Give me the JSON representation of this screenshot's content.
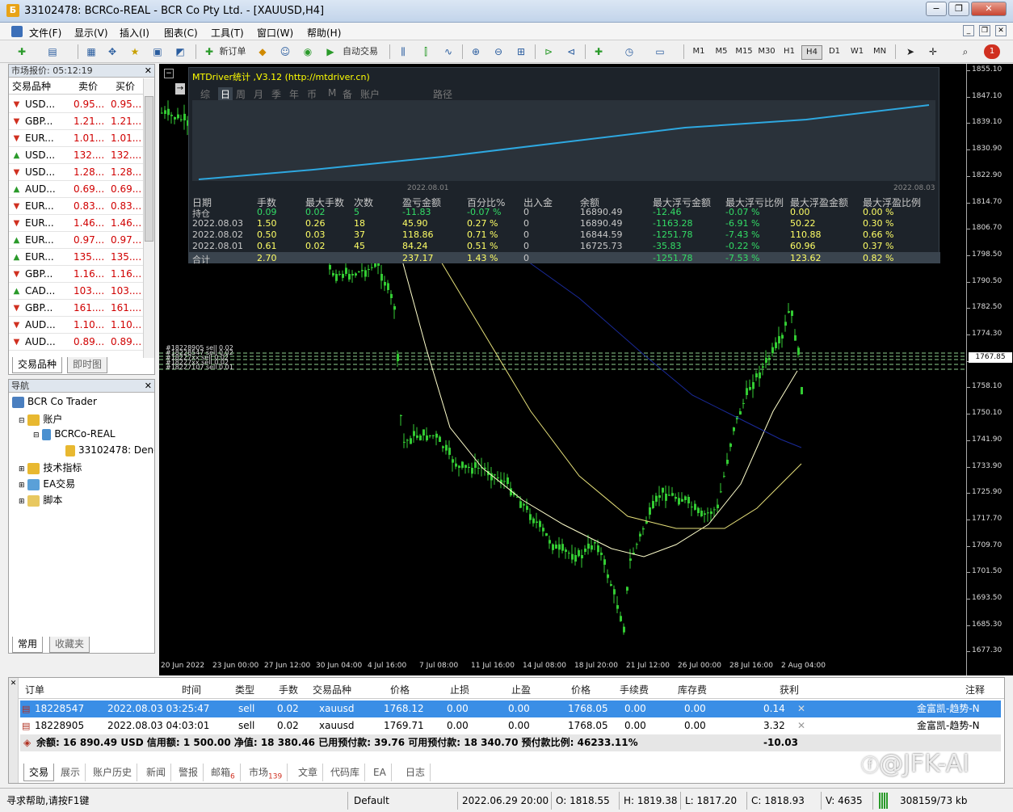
{
  "window": {
    "title": "33102478: BCRCo-REAL - BCR Co Pty Ltd. - [XAUUSD,H4]",
    "minimize": "−",
    "restore": "❐",
    "close": "✕"
  },
  "menu": [
    "文件(F)",
    "显示(V)",
    "插入(I)",
    "图表(C)",
    "工具(T)",
    "窗口(W)",
    "帮助(H)"
  ],
  "toolbar": {
    "new_order": "新订单",
    "auto_trade": "自动交易",
    "timeframes": [
      "M1",
      "M5",
      "M15",
      "M30",
      "H1",
      "H4",
      "D1",
      "W1",
      "MN"
    ],
    "active_tf": "H4",
    "alert_count": "1"
  },
  "market_watch": {
    "title": "市场报价: 05:12:19",
    "col_symbol": "交易品种",
    "col_bid": "卖价",
    "col_ask": "买价",
    "rows": [
      {
        "symbol": "USD...",
        "bid": "0.95...",
        "ask": "0.95...",
        "dir": "down"
      },
      {
        "symbol": "GBP...",
        "bid": "1.21...",
        "ask": "1.21...",
        "dir": "down"
      },
      {
        "symbol": "EUR...",
        "bid": "1.01...",
        "ask": "1.01...",
        "dir": "down"
      },
      {
        "symbol": "USD...",
        "bid": "132....",
        "ask": "132....",
        "dir": "up"
      },
      {
        "symbol": "USD...",
        "bid": "1.28...",
        "ask": "1.28...",
        "dir": "down"
      },
      {
        "symbol": "AUD...",
        "bid": "0.69...",
        "ask": "0.69...",
        "dir": "up"
      },
      {
        "symbol": "EUR...",
        "bid": "0.83...",
        "ask": "0.83...",
        "dir": "down"
      },
      {
        "symbol": "EUR...",
        "bid": "1.46...",
        "ask": "1.46...",
        "dir": "down"
      },
      {
        "symbol": "EUR...",
        "bid": "0.97...",
        "ask": "0.97...",
        "dir": "up"
      },
      {
        "symbol": "EUR...",
        "bid": "135....",
        "ask": "135....",
        "dir": "up"
      },
      {
        "symbol": "GBP...",
        "bid": "1.16...",
        "ask": "1.16...",
        "dir": "down"
      },
      {
        "symbol": "CAD...",
        "bid": "103....",
        "ask": "103....",
        "dir": "up"
      },
      {
        "symbol": "GBP...",
        "bid": "161....",
        "ask": "161....",
        "dir": "down"
      },
      {
        "symbol": "AUD...",
        "bid": "1.10...",
        "ask": "1.10...",
        "dir": "down"
      },
      {
        "symbol": "AUD...",
        "bid": "0.89...",
        "ask": "0.89...",
        "dir": "down"
      }
    ],
    "tabs": [
      "交易品种",
      "即时图"
    ]
  },
  "navigator": {
    "title": "导航",
    "items": [
      "BCR Co Trader",
      "账户",
      "BCRCo-REAL",
      "33102478: Deng",
      "技术指标",
      "EA交易",
      "脚本"
    ],
    "tabs": [
      "常用",
      "收藏夹"
    ]
  },
  "chart": {
    "indicator_title": "MTDriver统计 ,V3.12 (http://mtdriver.cn)",
    "stat_tabs": [
      "综",
      "日",
      "周",
      "月",
      "季",
      "年",
      "币",
      "M",
      "备",
      "账户",
      "路径"
    ],
    "active_stat_tab": "日",
    "curve_start_label": "2022.08.01",
    "curve_end_label": "2022.08.03",
    "stat_headers": [
      "日期",
      "手数",
      "最大手数",
      "次数",
      "盈亏金额",
      "百分比%",
      "出入金",
      "余额",
      "最大浮亏金额",
      "最大浮亏比例",
      "最大浮盈金额",
      "最大浮盈比例"
    ],
    "stat_rows": [
      [
        "持仓",
        "0.09",
        "0.02",
        "5",
        "-11.83",
        "-0.07 %",
        "0",
        "16890.49",
        "-12.46",
        "-0.07 %",
        "0.00",
        "0.00 %"
      ],
      [
        "2022.08.03",
        "1.50",
        "0.26",
        "18",
        "45.90",
        "0.27 %",
        "0",
        "16890.49",
        "-1163.28",
        "-6.91 %",
        "50.22",
        "0.30 %"
      ],
      [
        "2022.08.02",
        "0.50",
        "0.03",
        "37",
        "118.86",
        "0.71 %",
        "0",
        "16844.59",
        "-1251.78",
        "-7.43 %",
        "110.88",
        "0.66 %"
      ],
      [
        "2022.08.01",
        "0.61",
        "0.02",
        "45",
        "84.24",
        "0.51 %",
        "0",
        "16725.73",
        "-35.83",
        "-0.22 %",
        "60.96",
        "0.37 %"
      ]
    ],
    "stat_total": [
      "合计",
      "2.70",
      "",
      "",
      "237.17",
      "1.43 %",
      "0",
      "",
      "-1251.78",
      "-7.53 %",
      "123.62",
      "0.82 %"
    ],
    "order_labels": [
      "#18228905 sell 0.02",
      "#18228547 sell 0.02",
      "#18227xx sell 0.02",
      "#18227xx sell 0.02",
      "#18227107 sell 0.01"
    ],
    "price_labels": [
      "1855.10",
      "1847.10",
      "1839.10",
      "1830.90",
      "1822.90",
      "1814.70",
      "1806.70",
      "1798.50",
      "1790.50",
      "1782.50",
      "1774.30",
      "1766.30",
      "1758.10",
      "1750.10",
      "1741.90",
      "1733.90",
      "1725.90",
      "1717.70",
      "1709.70",
      "1701.50",
      "1693.50",
      "1685.30",
      "1677.30"
    ],
    "current_price": "1767.85",
    "time_labels": [
      "20 Jun 2022",
      "23 Jun 00:00",
      "27 Jun 12:00",
      "30 Jun 04:00",
      "4 Jul 16:00",
      "7 Jul 08:00",
      "11 Jul 16:00",
      "14 Jul 08:00",
      "18 Jul 20:00",
      "21 Jul 12:00",
      "26 Jul 00:00",
      "28 Jul 16:00",
      "2 Aug 04:00"
    ],
    "colors": {
      "up_candle": "#33cc33",
      "panel_bg": "#1d232a",
      "curve": "#2ea8e0",
      "ma_fast": "#ffffcc",
      "ma_slow": "#e6e07a",
      "ma_long": "#1a2a9a"
    }
  },
  "orders": {
    "headers": {
      "order": "订单",
      "time": "时间",
      "type": "类型",
      "lots": "手数",
      "symbol": "交易品种",
      "price": "价格",
      "sl": "止损",
      "tp": "止盈",
      "cur_price": "价格",
      "commission": "手续费",
      "swap": "库存费",
      "profit": "获利",
      "comment": "注释"
    },
    "rows": [
      {
        "order": "18228547",
        "time": "2022.08.03 03:25:47",
        "type": "sell",
        "lots": "0.02",
        "symbol": "xauusd",
        "price": "1768.12",
        "sl": "0.00",
        "tp": "0.00",
        "cur_price": "1768.05",
        "commission": "0.00",
        "swap": "0.00",
        "profit": "0.14",
        "comment": "金富凯-趋势-N",
        "selected": true
      },
      {
        "order": "18228905",
        "time": "2022.08.03 04:03:01",
        "type": "sell",
        "lots": "0.02",
        "symbol": "xauusd",
        "price": "1769.71",
        "sl": "0.00",
        "tp": "0.00",
        "cur_price": "1768.05",
        "commission": "0.00",
        "swap": "0.00",
        "profit": "3.32",
        "comment": "金富凯-趋势-N",
        "selected": false
      }
    ],
    "summary": "余额: 16 890.49 USD  信用额: 1 500.00  净值: 18 380.46  已用预付款: 39.76  可用预付款: 18 340.70  预付款比例: 46233.11%",
    "summary_profit": "-10.03",
    "tabs": [
      {
        "label": "交易",
        "badge": ""
      },
      {
        "label": "展示",
        "badge": ""
      },
      {
        "label": "账户历史",
        "badge": ""
      },
      {
        "label": "新闻",
        "badge": ""
      },
      {
        "label": "警报",
        "badge": ""
      },
      {
        "label": "邮箱",
        "badge": "6"
      },
      {
        "label": "市场",
        "badge": "139"
      },
      {
        "label": "文章",
        "badge": ""
      },
      {
        "label": "代码库",
        "badge": ""
      },
      {
        "label": "EA",
        "badge": ""
      },
      {
        "label": "日志",
        "badge": ""
      }
    ]
  },
  "statusbar": {
    "help": "寻求帮助,请按F1键",
    "profile": "Default",
    "datetime": "2022.06.29 20:00",
    "open": "O: 1818.55",
    "high": "H: 1819.38",
    "low": "L: 1817.20",
    "close": "C: 1818.93",
    "volume": "V: 4635",
    "traffic": "308159/73 kb",
    "watermark": "@JFK-AI"
  }
}
